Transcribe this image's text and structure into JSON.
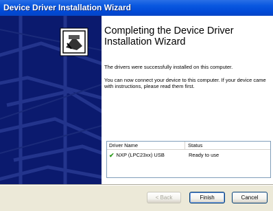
{
  "window": {
    "title": "Device Driver Installation Wizard"
  },
  "content": {
    "heading": "Completing the Device Driver Installation Wizard",
    "paragraph1": "The drivers were successfully installed on this computer.",
    "paragraph2": "You can now connect your device to this computer. If your device came with instructions, please read them first."
  },
  "driver_list": {
    "headers": {
      "name": "Driver Name",
      "status": "Status"
    },
    "rows": [
      {
        "name": "NXP (LPC23xx) USB",
        "status": "Ready to use"
      }
    ]
  },
  "buttons": {
    "back": "< Back",
    "finish": "Finish",
    "cancel": "Cancel"
  },
  "colors": {
    "titlebar": "#0049d6",
    "side_panel": "#0b1a6e",
    "check": "#2a9a1a"
  }
}
